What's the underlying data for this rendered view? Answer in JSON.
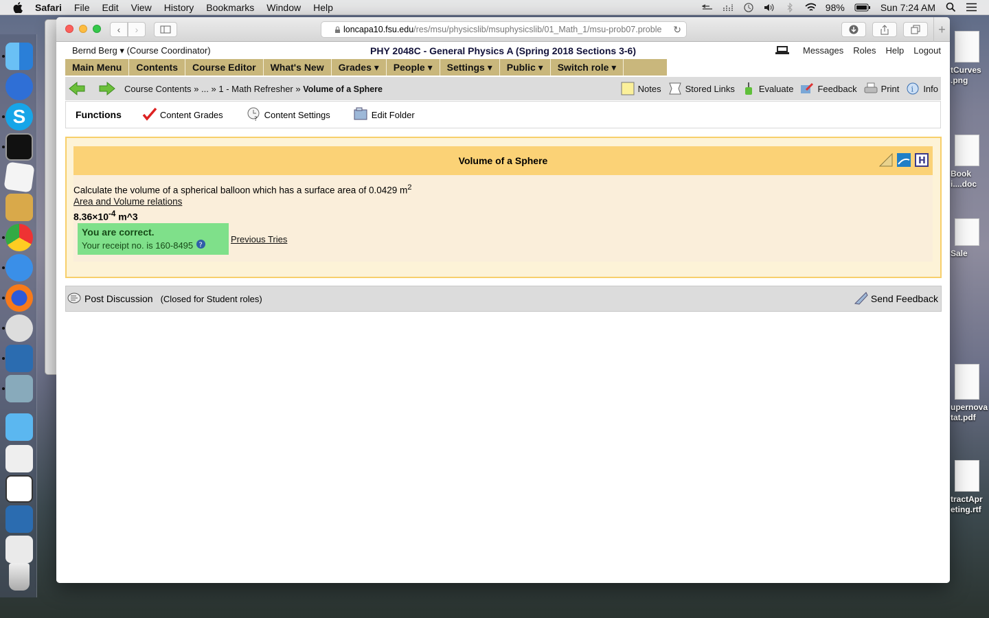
{
  "menubar": {
    "app": "Safari",
    "items": [
      "File",
      "Edit",
      "View",
      "History",
      "Bookmarks",
      "Window",
      "Help"
    ],
    "battery": "98%",
    "clock": "Sun 7:24 AM"
  },
  "browser": {
    "url_host": "loncapa10.fsu.edu",
    "url_path": "/res/msu/physicslib/msuphysicslib/01_Math_1/msu-prob07.proble"
  },
  "header": {
    "user": "Bernd Berg ▾",
    "role": "(Course Coordinator)",
    "course": "PHY 2048C - General Physics A (Spring 2018 Sections 3-6)",
    "links": [
      "Messages",
      "Roles",
      "Help",
      "Logout"
    ]
  },
  "nav": {
    "items": [
      "Main Menu",
      "Contents",
      "Course Editor",
      "What's New",
      "Grades ▾",
      "People ▾",
      "Settings ▾",
      "Public ▾",
      "Switch role ▾"
    ]
  },
  "breadcrumb": {
    "c1": "Course Contents",
    "sep": "»",
    "c2": "...",
    "c3": "1 - Math Refresher",
    "current": "Volume of a Sphere"
  },
  "tools": [
    "Notes",
    "Stored Links",
    "Evaluate",
    "Feedback",
    "Print",
    "Info"
  ],
  "functions": {
    "title": "Functions",
    "items": [
      "Content Grades",
      "Content Settings",
      "Edit Folder"
    ]
  },
  "problem": {
    "title": "Volume of a Sphere",
    "question": "Calculate the volume of a spherical balloon which has a surface area of 0.0429 m",
    "question_sup": "2",
    "hint_link": "Area and Volume relations",
    "answer_base": "8.36×10",
    "answer_exp": "-4",
    "answer_unit": " m^3",
    "correct": "You are correct.",
    "receipt": "Your receipt no. is 160-8495",
    "prev_tries": "Previous Tries"
  },
  "discussion": {
    "post": "Post Discussion",
    "closed": "(Closed for Student roles)",
    "send": "Send Feedback"
  },
  "desktop_files": [
    "tCurves\n.png",
    "Book\ni....doc",
    "Sale",
    "upernova\ntat.pdf",
    "tractApr\neting.rtf"
  ],
  "colors": {
    "nav_bg": "#c9b77c",
    "problem_header": "#fbd276",
    "problem_border": "#f7cf6a",
    "correct_bg": "#7fe08a"
  }
}
